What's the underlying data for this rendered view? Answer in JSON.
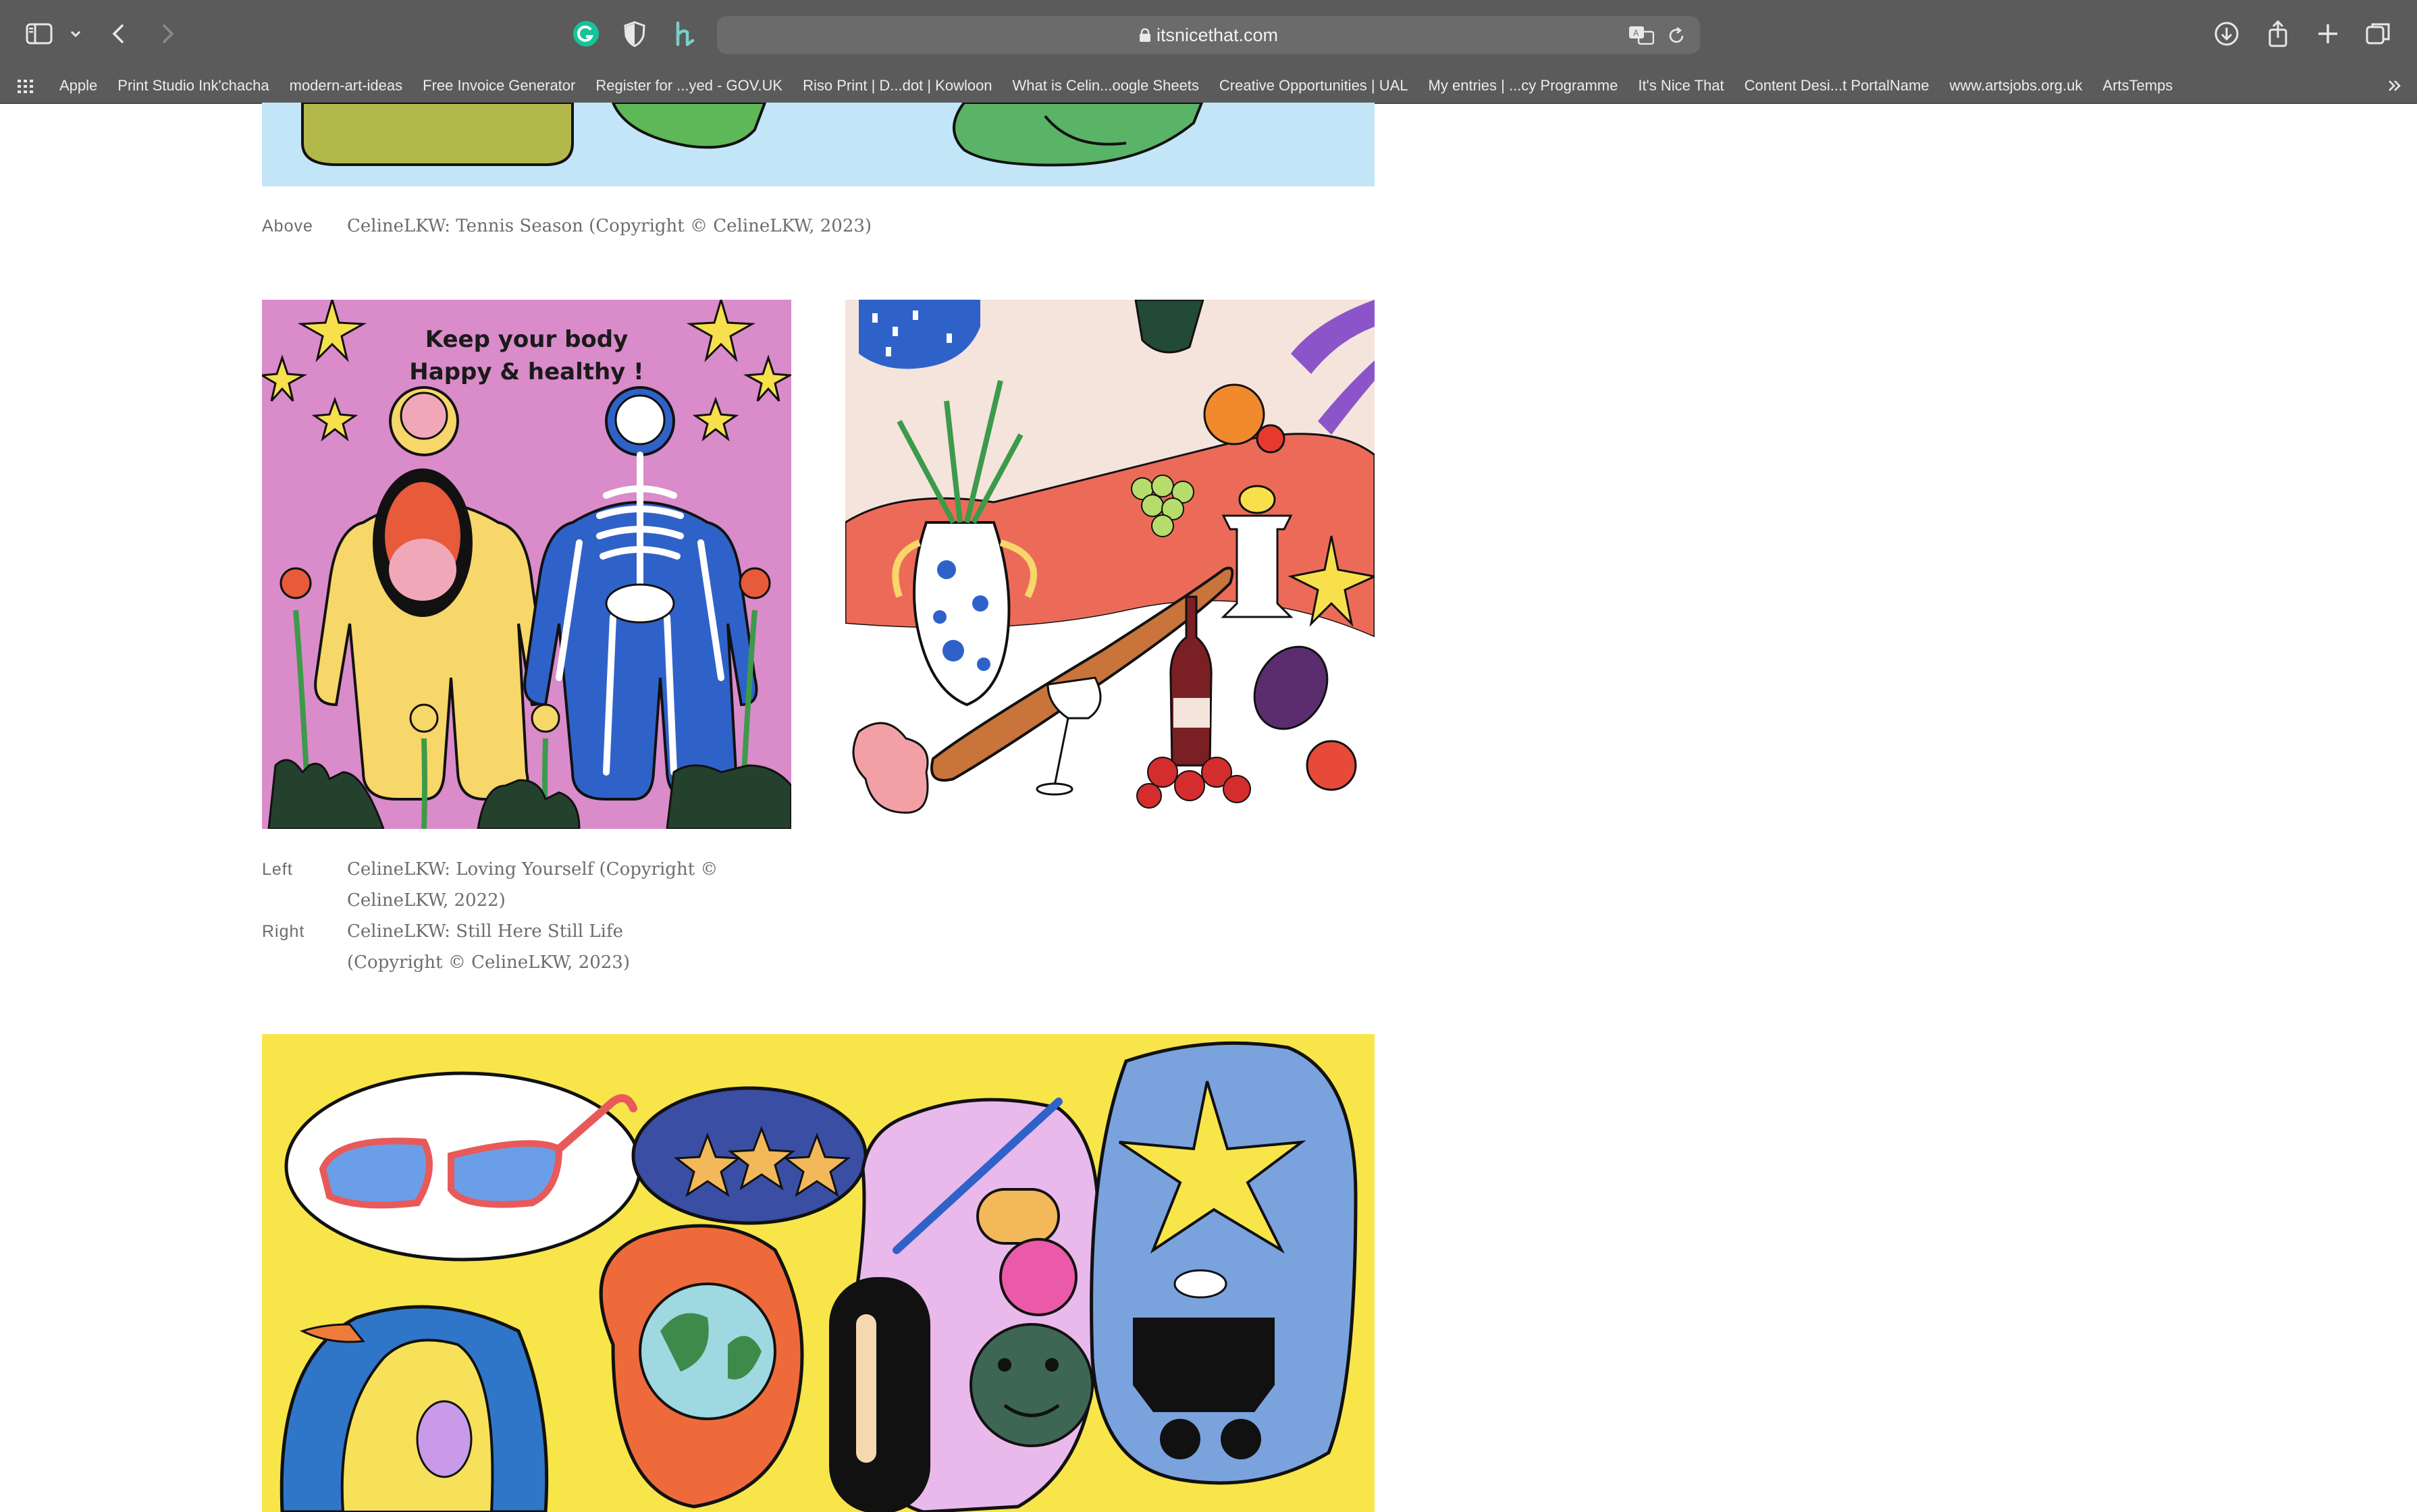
{
  "browser": {
    "url": "itsnicethat.com",
    "bookmarks": [
      "Apple",
      "Print Studio Ink'chacha",
      "modern-art-ideas",
      "Free Invoice Generator",
      "Register for ...yed - GOV.UK",
      "Riso Print | D...dot | Kowloon",
      "What is Celin...oogle Sheets",
      "Creative Opportunities | UAL",
      "My entries | ...cy Programme",
      "It's Nice That",
      "Content Desi...t PortalName",
      "www.artsjobs.org.uk",
      "ArtsTemps"
    ],
    "icons": {
      "sidebar": "sidebar-icon",
      "back": "chevron-left-icon",
      "forward": "chevron-right-icon",
      "grammarly": "grammarly-icon",
      "privacy": "shield-icon",
      "extension": "h-extension-icon",
      "translate": "translate-icon",
      "reload": "reload-icon",
      "downloads": "download-icon",
      "share": "share-icon",
      "new_tab": "plus-icon",
      "tabs": "tabs-overview-icon",
      "apps": "grid-icon",
      "more_bookmarks": "chevrons-right-icon"
    }
  },
  "article": {
    "captions": {
      "above": {
        "label": "Above",
        "text": "CelineLKW: Tennis Season (Copyright © CelineLKW, 2023)"
      },
      "left": {
        "label": "Left",
        "line1": "CelineLKW: Loving Yourself (Copyright ©",
        "line2": "CelineLKW, 2022)"
      },
      "right": {
        "label": "Right",
        "line1": "CelineLKW: Still Here Still Life",
        "line2": "(Copyright © CelineLKW, 2023)"
      }
    },
    "images": {
      "loving_yourself": {
        "text_line1": "Keep your body",
        "text_line2": "Happy & healthy !"
      }
    }
  },
  "colors": {
    "chrome": "#5b5b5b",
    "address_bar": "#6b6b6b",
    "caption": "#6d6d6d",
    "pink": "#d98cc9",
    "yellow": "#f7e04c",
    "sky": "#c3e5f8"
  }
}
